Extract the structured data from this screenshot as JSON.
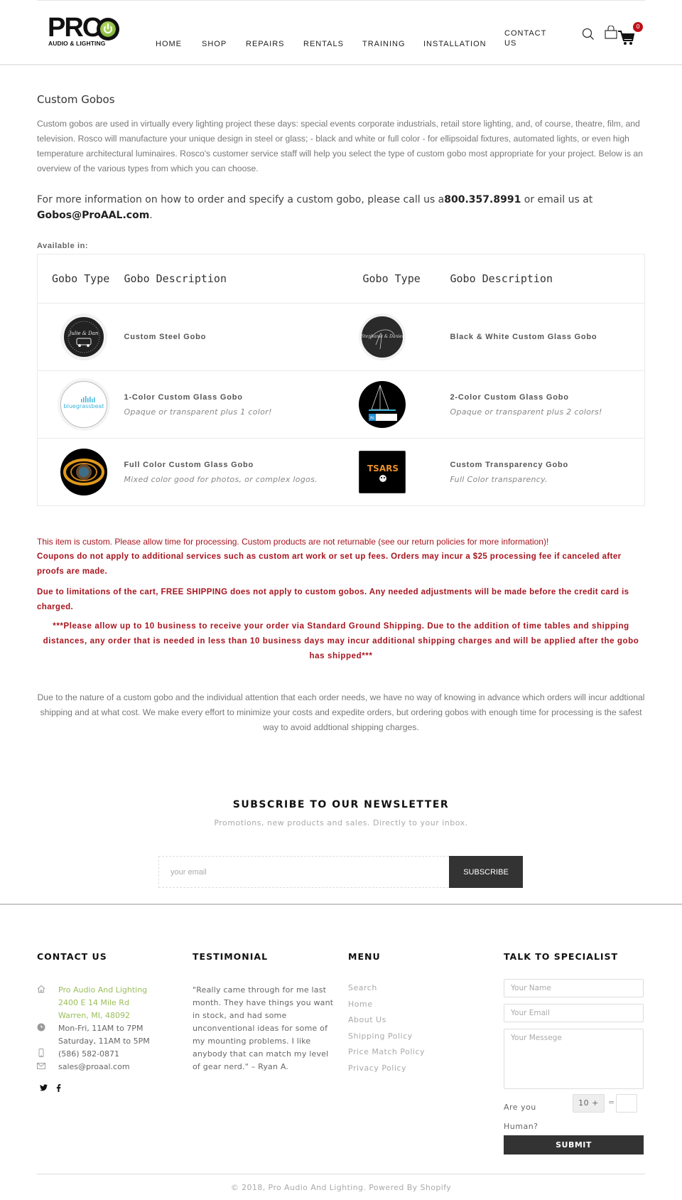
{
  "header": {
    "logo_text": "PRO",
    "logo_sub": "AUDIO & LIGHTING",
    "nav": [
      "HOME",
      "SHOP",
      "REPAIRS",
      "RENTALS",
      "TRAINING",
      "INSTALLATION",
      "CONTACT",
      "US"
    ],
    "cart_count": "0"
  },
  "page": {
    "title": "Custom Gobos",
    "intro": "Custom gobos are used in virtually every lighting project these days: special events corporate industrials, retail store lighting, and, of course, theatre, film, and television. Rosco will manufacture your unique design in steel or glass; - black and white or full color - for ellipsoidal fixtures, automated lights, or even high temperature architectural luminaires. Rosco's customer service staff will help you select the type of custom gobo most appropriate for your project. Below is an overview of the various types from which you can choose.",
    "info_prefix": "For more information on how to order and specify a custom gobo, please call us a",
    "info_phone": "800.357.8991",
    "info_mid": " or email us at ",
    "info_email": "Gobos@ProAAL.com",
    "info_suffix": ".",
    "available_label": "Available in:"
  },
  "table": {
    "headers": [
      "Gobo Type",
      "Gobo Description",
      "Gobo Type",
      "Gobo Description"
    ],
    "rows": [
      [
        {
          "icon": "steel-gobo-image",
          "name": "Custom Steel Gobo",
          "desc": ""
        },
        {
          "icon": "bw-glass-gobo-image",
          "name": "Black & White Custom Glass Gobo",
          "desc": ""
        }
      ],
      [
        {
          "icon": "one-color-gobo-image",
          "name": "1-Color Custom Glass Gobo",
          "desc": "Opaque or transparent plus 1 color!"
        },
        {
          "icon": "two-color-gobo-image",
          "name": "2-Color Custom Glass Gobo",
          "desc": "Opaque or transparent plus 2 colors!"
        }
      ],
      [
        {
          "icon": "full-color-gobo-image",
          "name": "Full Color Custom Glass Gobo",
          "desc": "Mixed color good for photos, or complex logos."
        },
        {
          "icon": "transparency-gobo-image",
          "name": "Custom Transparency Gobo",
          "desc": "Full Color transparency."
        }
      ]
    ]
  },
  "notices": {
    "custom": "This item is custom. Please allow time for processing. Custom products are not returnable (see our return policies for more information)!",
    "coupons": "Coupons do not apply to additional services such as custom art work or set up fees. Orders may incur a $25 processing fee if canceled after proofs are made.",
    "shipping": "Due to limitations of the cart, FREE SHIPPING does not apply to custom gobos.  Any needed adjustments will be made before the credit card is charged.",
    "allow": "***Please allow up to 10 business to receive your order via Standard Ground Shipping.  Due to the addition of time tables and shipping distances, any order that is needed in less than 10 business days may incur additional shipping charges and will be applied after the gobo has shipped***",
    "nature": "Due to the nature of a custom gobo and the individual attention that each order needs, we have no way of knowing in advance which orders will incur addtional shipping and at what cost. We make every effort to minimize your costs and expedite orders, but ordering gobos with enough time for processing is the safest way to avoid addtional shipping charges."
  },
  "newsletter": {
    "title": "SUBSCRIBE TO OUR NEWSLETTER",
    "subtitle": "Promotions, new products and sales. Directly to your inbox.",
    "placeholder": "your email",
    "button": "SUBSCRIBE"
  },
  "footer": {
    "contact": {
      "title": "CONTACT US",
      "address": [
        "Pro Audio And Lighting",
        "2400 E 14 Mile Rd",
        "Warren, MI, 48092"
      ],
      "hours": [
        "Mon-Fri, 11AM to 7PM",
        "Saturday, 11AM to 5PM"
      ],
      "phone": "(586) 582-0871",
      "email": "sales@proaal.com"
    },
    "testimonial": {
      "title": "TESTIMONIAL",
      "text": "\"Really came through for me last month. They have things you want in stock, and had some unconventional ideas for some of my mounting problems. I like anybody that can match my level of gear nerd.\" – Ryan A."
    },
    "menu": {
      "title": "MENU",
      "items": [
        "Search",
        "Home",
        "About Us",
        "Shipping Policy",
        "Price Match Policy",
        "Privacy Policy"
      ]
    },
    "specialist": {
      "title": "TALK TO SPECIALIST",
      "name_placeholder": "Your Name",
      "email_placeholder": "Your Email",
      "message_placeholder": "Your Messege",
      "human_label_1": "Are you",
      "human_label_2": "Human?",
      "captcha": "10 +",
      "equals": "=",
      "submit": "SUBMIT"
    },
    "copyright": "© 2018, Pro Audio And Lighting. Powered By Shopify"
  }
}
